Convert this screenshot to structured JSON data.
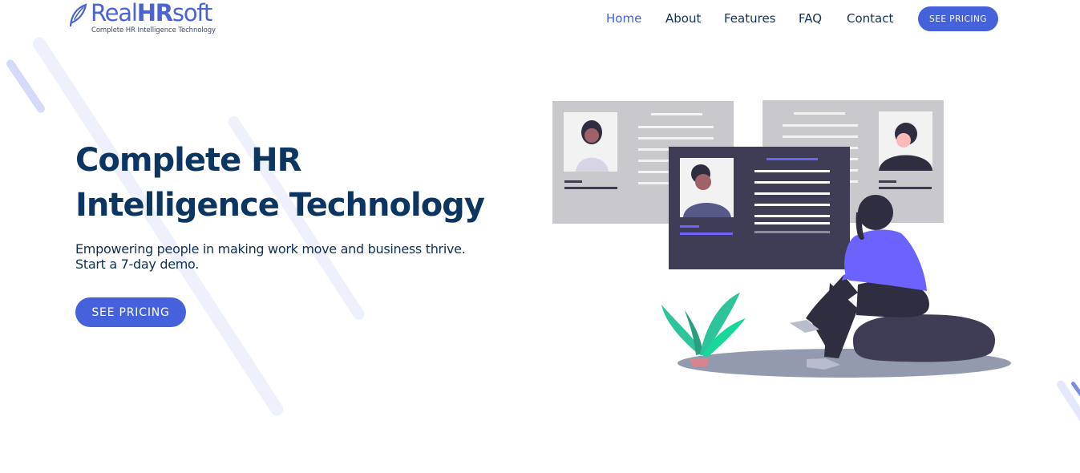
{
  "brand": {
    "name_light_1": "Real",
    "name_bold": "HR",
    "name_light_2": "soft",
    "tagline": "Complete HR Intelligence Technology",
    "leaf_icon": "leaf-logo-icon"
  },
  "nav": {
    "items": [
      {
        "label": "Home",
        "active": true
      },
      {
        "label": "About",
        "active": false
      },
      {
        "label": "Features",
        "active": false
      },
      {
        "label": "FAQ",
        "active": false
      },
      {
        "label": "Contact",
        "active": false
      }
    ],
    "cta_label": "SEE PRICING"
  },
  "hero": {
    "title_line1": "Complete HR",
    "title_line2": "Intelligence Technology",
    "subtitle_line1": "Empowering people in making work move and business thrive.",
    "subtitle_line2": "Start a 7-day demo.",
    "cta_label": "SEE PRICING"
  },
  "colors": {
    "accent": "#4561dc",
    "heading": "#0d3561",
    "streak": "#e8ebfb",
    "illustration_purple": "#6c63ff",
    "illustration_dark": "#3f3d56",
    "illustration_green": "#2ec49b"
  }
}
